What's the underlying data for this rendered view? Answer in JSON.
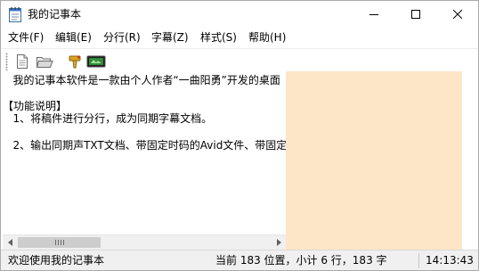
{
  "window": {
    "title": "我的记事本",
    "controls": {
      "minimize": "minimize",
      "maximize": "maximize",
      "close": "close"
    }
  },
  "menu": [
    {
      "label": "文件(F)"
    },
    {
      "label": "编辑(E)"
    },
    {
      "label": "分行(R)"
    },
    {
      "label": "字幕(Z)"
    },
    {
      "label": "样式(S)"
    },
    {
      "label": "帮助(H)"
    }
  ],
  "toolbar": {
    "icons": [
      "new-document-icon",
      "open-folder-icon",
      "export-icon",
      "subtitle-icon"
    ]
  },
  "editor": {
    "lines": [
      "   我的记事本软件是一款由个人作者“一曲阳勇”开发的桌面",
      "",
      "【功能说明】",
      "   1、将稿件进行分行，成为同期字幕文档。",
      "",
      "   2、输出同期声TXT文档、带固定时码的Avid文件、带固定"
    ],
    "side_panel_color": "#fde5c8"
  },
  "statusbar": {
    "message": "欢迎使用我的记事本",
    "position": "当前 183 位置，小计 6 行，183 字",
    "time": "14:13:43"
  }
}
